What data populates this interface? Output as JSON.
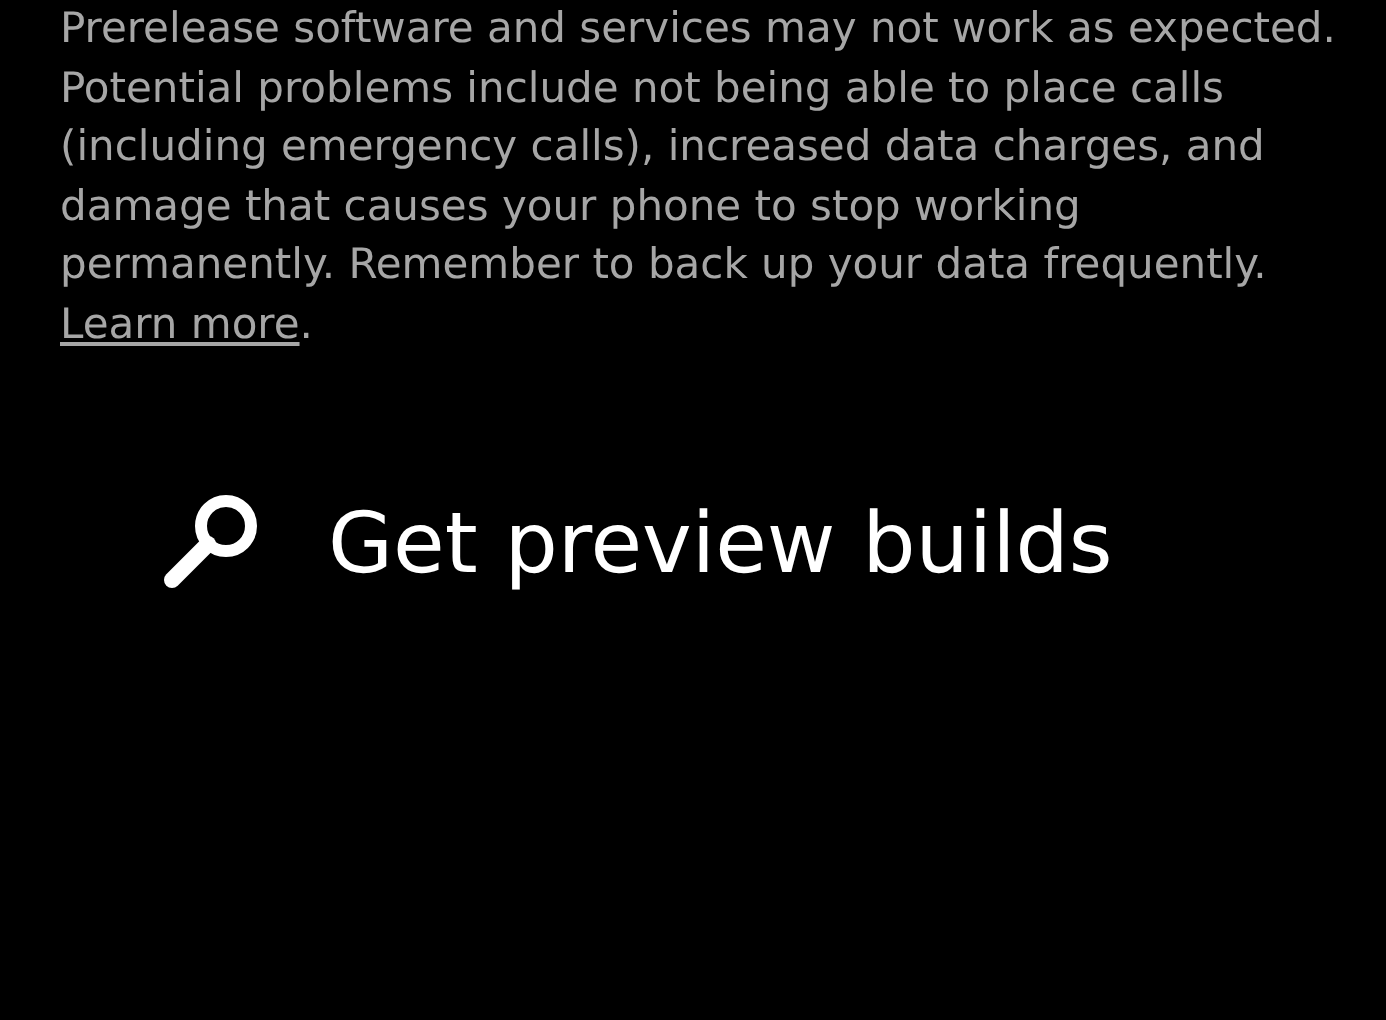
{
  "warning": {
    "text": "Prerelease software and services may not work as expected. Potential problems include not being able to place calls (including emergency calls), increased data charges, and damage that causes your phone to stop working permanently. Remember to back up your data frequently.",
    "link": "Learn more",
    "end": "."
  },
  "action": {
    "label": "Get preview builds"
  }
}
